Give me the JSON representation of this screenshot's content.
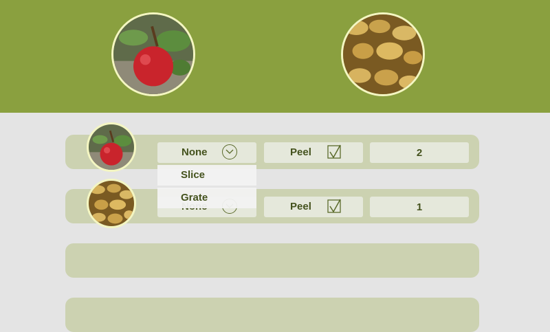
{
  "hero": [
    {
      "name": "apple",
      "icon": "apple-image"
    },
    {
      "name": "potato",
      "icon": "potato-image"
    }
  ],
  "rows": [
    {
      "item": "apple",
      "prep": "None",
      "peel_label": "Peel",
      "peeled": true,
      "quantity": "2"
    },
    {
      "item": "potato",
      "prep": "None",
      "peel_label": "Peel",
      "peeled": true,
      "quantity": "1"
    }
  ],
  "dropdown": {
    "options": [
      "Slice",
      "Grate"
    ]
  },
  "colors": {
    "header": "#8aa03f",
    "background": "#e4e4e4",
    "row": "#ccd2b1",
    "pill": "#e5e8db",
    "text": "#44521d",
    "ring": "#f4f6c2"
  }
}
